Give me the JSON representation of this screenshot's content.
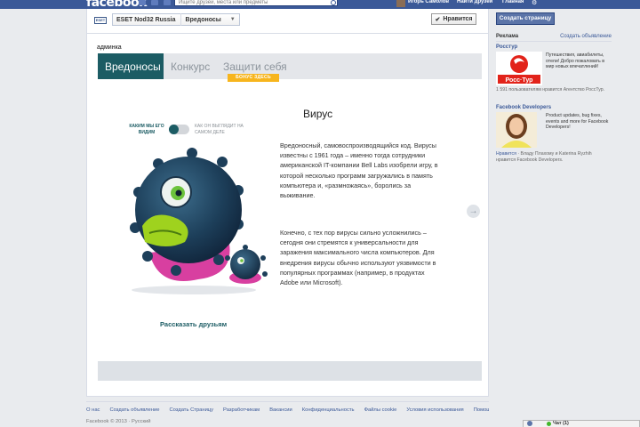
{
  "topbar": {
    "logo": "facebook",
    "search_placeholder": "Ищите друзей, места или предметы",
    "user_name": "Игорь Самолов",
    "find_friends": "Найти друзей",
    "home": "Главная"
  },
  "page_head": {
    "brand_badge": "ESET",
    "page_name": "ESET Nod32 Russia",
    "app_name": "Вредоносы",
    "like_label": "Нравится",
    "like_check": "✔"
  },
  "admin_label": "админка",
  "tabs": [
    {
      "label": "Вредоносы",
      "active": true
    },
    {
      "label": "Конкурс",
      "active": false
    },
    {
      "label": "Защити себя",
      "active": false
    }
  ],
  "bonus_badge": "БОНУС ЗДЕСЬ",
  "content": {
    "title": "Вирус",
    "toggle_left": "КАКИМ МЫ ЕГО ВИДИМ",
    "toggle_right": "КАК ОН ВЫГЛЯДИТ НА САМОМ ДЕЛЕ",
    "paragraphs": [
      "Вредоносный, самовоспроизводящийся код. Вирусы известны с 1961 года – именно тогда сотрудники американской IT-компании Bell Labs изобрели игру, в которой несколько программ загружались в память компьютера и, «размножаясь», боролись за выживание.",
      "Конечно, с тех пор вирусы сильно усложнились – сегодня они стремятся к универсальности для заражения максимального числа компьютеров. Для внедрения вирусы обычно используют уязвимости в популярных программах (например, в продуктах Adobe или Microsoft)."
    ],
    "share_link": "Рассказать друзьям",
    "next_arrow": "→"
  },
  "sidebar": {
    "create_page": "Создать страницу",
    "ads_title": "Реклама",
    "create_ad": "Создать объявление",
    "ads": [
      {
        "title": "Росстур",
        "logo_text": "Росс·Тур",
        "text": "Путешествия, авиабилеты, отели! Добро пожаловать в мир новых впечатлений!",
        "likes": "1 591 пользователям нравится Агентство РоссТур."
      },
      {
        "title": "Facebook Developers",
        "text": "Product updates, bug fixes, events and more for Facebook Developers!",
        "likes_link": "Нравится",
        "likes": " · Владу Плахому и Katerina Ryzhih нравится Facebook Developers."
      }
    ]
  },
  "footer": {
    "links": [
      "О нас",
      "Создать объявление",
      "Создать Страницу",
      "Разработчикам",
      "Вакансии",
      "Конфиденциальность",
      "Файлы cookie",
      "Условия использования",
      "Помощь"
    ],
    "copyright": "Facebook © 2013 · Русский"
  },
  "chat": {
    "label": "Чат (1)"
  },
  "colors": {
    "facebook_blue": "#3b5998",
    "tab_active": "#1c5c64",
    "bonus": "#f7b51d",
    "virus_body": "#1d3f5a",
    "virus_lip": "#9fd21e",
    "virus_base": "#d83fa0"
  }
}
